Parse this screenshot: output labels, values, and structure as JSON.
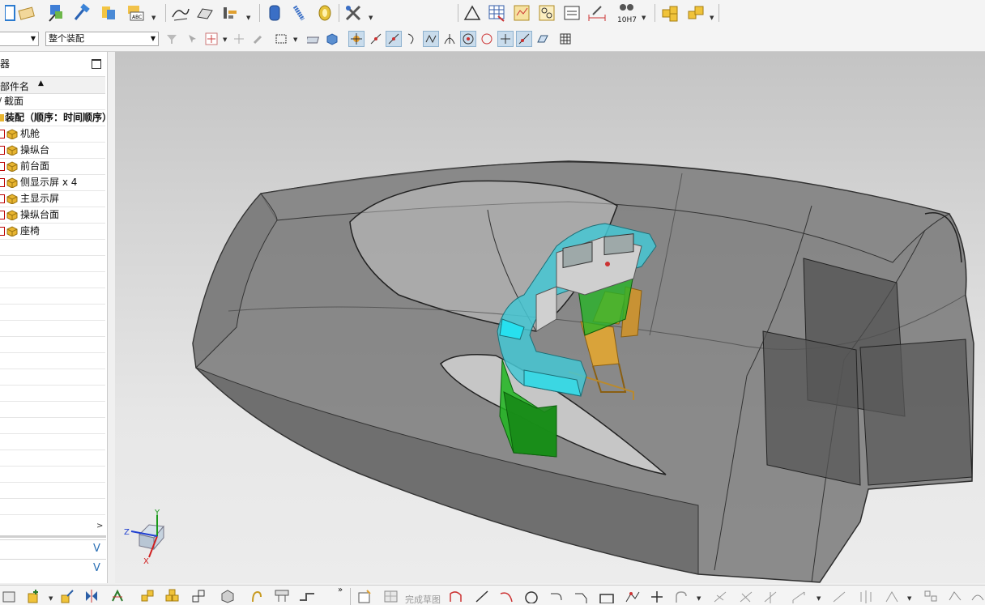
{
  "toolbar": {
    "assembly_scope": "整个装配",
    "first_combo": "",
    "tolerance_label": "10H7"
  },
  "navigator": {
    "title": "器",
    "column_header": "部件名",
    "rows": [
      {
        "label": "截面"
      },
      {
        "label": "装配（顺序：时间顺序）"
      },
      {
        "label": "机舱"
      },
      {
        "label": "操纵台"
      },
      {
        "label": "前台面"
      },
      {
        "label": "侧显示屏 x 4"
      },
      {
        "label": "主显示屏"
      },
      {
        "label": "操纵台面"
      },
      {
        "label": "座椅"
      }
    ]
  },
  "triad": {
    "x": "X",
    "y": "Y",
    "z": "Z"
  },
  "bottom_toolbar": {
    "finish_sketch": "完成草图"
  },
  "colors": {
    "hull": "#6b6b6b",
    "console_cyan": "#45c7d3",
    "console_green": "#1fb51f",
    "seat_yellow": "#d9a33a",
    "part_cube": "#e8b531"
  }
}
